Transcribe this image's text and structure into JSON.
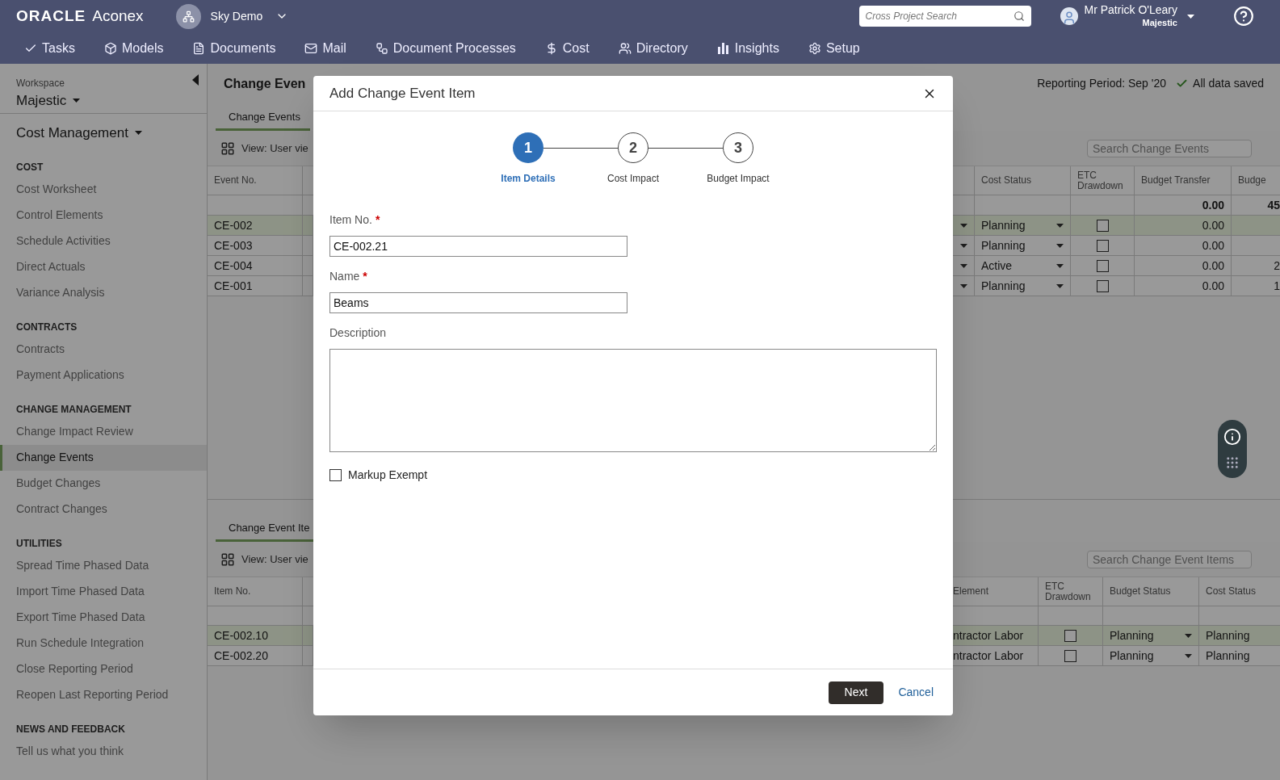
{
  "header": {
    "logo_brand": "ORACLE",
    "logo_product": "Aconex",
    "project": "Sky Demo",
    "search": {
      "placeholder": "Cross Project Search"
    },
    "user": {
      "name": "Mr Patrick O'Leary",
      "organization": "Majestic"
    }
  },
  "nav": [
    {
      "label": "Tasks"
    },
    {
      "label": "Models"
    },
    {
      "label": "Documents"
    },
    {
      "label": "Mail"
    },
    {
      "label": "Document Processes"
    },
    {
      "label": "Cost"
    },
    {
      "label": "Directory"
    },
    {
      "label": "Insights"
    },
    {
      "label": "Setup"
    }
  ],
  "sidebar": {
    "workspace_label": "Workspace",
    "workspace": "Majestic",
    "module": "Cost Management",
    "sections": [
      {
        "title": "COST",
        "items": [
          {
            "label": "Cost Worksheet",
            "selected": false
          },
          {
            "label": "Control Elements",
            "selected": false
          },
          {
            "label": "Schedule Activities",
            "selected": false
          },
          {
            "label": "Direct Actuals",
            "selected": false
          },
          {
            "label": "Variance Analysis",
            "selected": false
          }
        ]
      },
      {
        "title": "CONTRACTS",
        "items": [
          {
            "label": "Contracts",
            "selected": false
          },
          {
            "label": "Payment Applications",
            "selected": false
          }
        ]
      },
      {
        "title": "CHANGE MANAGEMENT",
        "items": [
          {
            "label": "Change Impact Review",
            "selected": false
          },
          {
            "label": "Change Events",
            "selected": true
          },
          {
            "label": "Budget Changes",
            "selected": false
          },
          {
            "label": "Contract Changes",
            "selected": false
          }
        ]
      },
      {
        "title": "UTILITIES",
        "items": [
          {
            "label": "Spread Time Phased Data",
            "selected": false
          },
          {
            "label": "Import Time Phased Data",
            "selected": false
          },
          {
            "label": "Export Time Phased Data",
            "selected": false
          },
          {
            "label": "Run Schedule Integration",
            "selected": false
          },
          {
            "label": "Close Reporting Period",
            "selected": false
          },
          {
            "label": "Reopen Last Reporting Period",
            "selected": false
          }
        ]
      },
      {
        "title": "NEWS AND FEEDBACK",
        "items": [
          {
            "label": "Tell us what you think",
            "selected": false
          }
        ]
      }
    ]
  },
  "page": {
    "title": "Change Even",
    "reporting_period": "Reporting Period: Sep '20",
    "save_status": "All data saved"
  },
  "events_panel": {
    "tab": "Change Events",
    "view": "View: User vie",
    "search": {
      "placeholder": "Search Change Events"
    },
    "columns": {
      "event_no": "Event No.",
      "cost_status": "Cost Status",
      "etc_drawdown": "ETC Drawdown",
      "budget_transfer": "Budget Transfer",
      "column_5": "Budge"
    },
    "totals": {
      "budget_transfer": "0.00",
      "column_5": "45"
    },
    "rows": [
      {
        "event_no": "CE-002",
        "selected": true,
        "cost_status": "Planning",
        "etc_drawdown": false,
        "budget_transfer": "0.00"
      },
      {
        "event_no": "CE-003",
        "selected": false,
        "cost_status": "Planning",
        "etc_drawdown": false,
        "budget_transfer": "0.00"
      },
      {
        "event_no": "CE-004",
        "selected": false,
        "cost_status": "Active",
        "etc_drawdown": false,
        "budget_transfer": "0.00",
        "column_5": "2"
      },
      {
        "event_no": "CE-001",
        "selected": false,
        "cost_status": "Planning",
        "etc_drawdown": false,
        "budget_transfer": "0.00",
        "column_5": "1"
      }
    ]
  },
  "items_panel": {
    "tab": "Change Event Ite",
    "view": "View: User vie",
    "search": {
      "placeholder": "Search Change Event Items"
    },
    "columns": {
      "item_no": "Item No.",
      "element": "Element",
      "etc_drawdown": "ETC Drawdown",
      "budget_status": "Budget Status",
      "cost_status": "Cost Status"
    },
    "rows": [
      {
        "item_no": "CE-002.10",
        "selected": true,
        "element": "ntractor Labor",
        "etc_drawdown": false,
        "budget_status": "Planning",
        "cost_status": "Planning"
      },
      {
        "item_no": "CE-002.20",
        "selected": false,
        "element": "ntractor Labor",
        "etc_drawdown": false,
        "budget_status": "Planning",
        "cost_status": "Planning"
      }
    ]
  },
  "modal": {
    "title": "Add Change Event Item",
    "steps": [
      {
        "number": "1",
        "label": "Item Details",
        "selected": true
      },
      {
        "number": "2",
        "label": "Cost Impact",
        "selected": false
      },
      {
        "number": "3",
        "label": "Budget Impact",
        "selected": false
      }
    ],
    "item_no": {
      "label": "Item No.",
      "required_mark": "*",
      "value": "CE-002.21"
    },
    "name": {
      "label": "Name",
      "required_mark": "*",
      "value": "Beams"
    },
    "description": {
      "label": "Description"
    },
    "markup_exempt": {
      "label": "Markup Exempt",
      "checked": false
    },
    "next": "Next",
    "cancel": "Cancel"
  }
}
